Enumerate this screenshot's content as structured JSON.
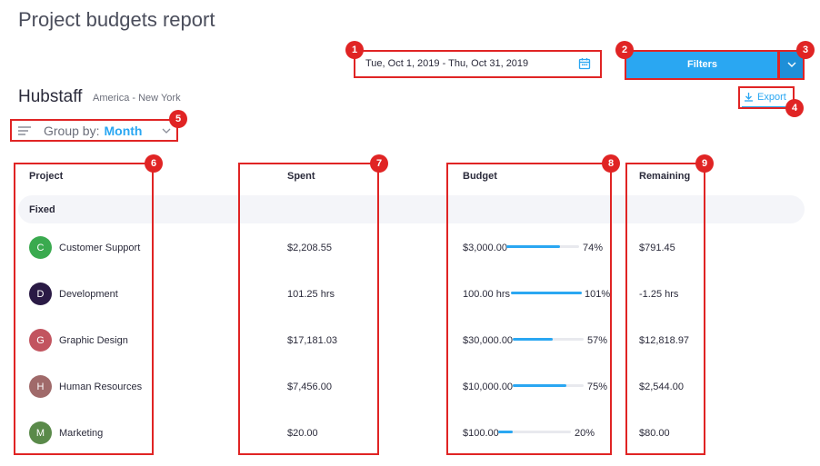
{
  "page": {
    "title": "Project budgets report"
  },
  "date_range": {
    "value": "Tue, Oct 1, 2019 - Thu, Oct 31, 2019"
  },
  "filters": {
    "label": "Filters"
  },
  "organization": {
    "name": "Hubstaff",
    "timezone": "America - New York"
  },
  "export": {
    "label": "Export"
  },
  "group_by": {
    "label": "Group by:",
    "value": "Month"
  },
  "columns": {
    "project": "Project",
    "spent": "Spent",
    "budget": "Budget",
    "remaining": "Remaining"
  },
  "group": {
    "label": "Fixed"
  },
  "rows": [
    {
      "initial": "C",
      "color": "#3aaa4f",
      "project": "Customer Support",
      "spent": "$2,208.55",
      "budget": "$3,000.00",
      "percent_label": "74%",
      "percent": 74,
      "remaining": "$791.45"
    },
    {
      "initial": "D",
      "color": "#2a1a45",
      "project": "Development",
      "spent": "101.25 hrs",
      "budget": "100.00 hrs",
      "percent_label": "101%",
      "percent": 101,
      "remaining": "-1.25 hrs"
    },
    {
      "initial": "G",
      "color": "#c2545f",
      "project": "Graphic Design",
      "spent": "$17,181.03",
      "budget": "$30,000.00",
      "percent_label": "57%",
      "percent": 57,
      "remaining": "$12,818.97"
    },
    {
      "initial": "H",
      "color": "#a06a6a",
      "project": "Human Resources",
      "spent": "$7,456.00",
      "budget": "$10,000.00",
      "percent_label": "75%",
      "percent": 75,
      "remaining": "$2,544.00"
    },
    {
      "initial": "M",
      "color": "#5a8a4a",
      "project": "Marketing",
      "spent": "$20.00",
      "budget": "$100.00",
      "percent_label": "20%",
      "percent": 20,
      "remaining": "$80.00"
    }
  ],
  "annotations": [
    "1",
    "2",
    "3",
    "4",
    "5",
    "6",
    "7",
    "8",
    "9"
  ],
  "colors": {
    "accent": "#2aa7f2",
    "annotation": "#e02424"
  }
}
